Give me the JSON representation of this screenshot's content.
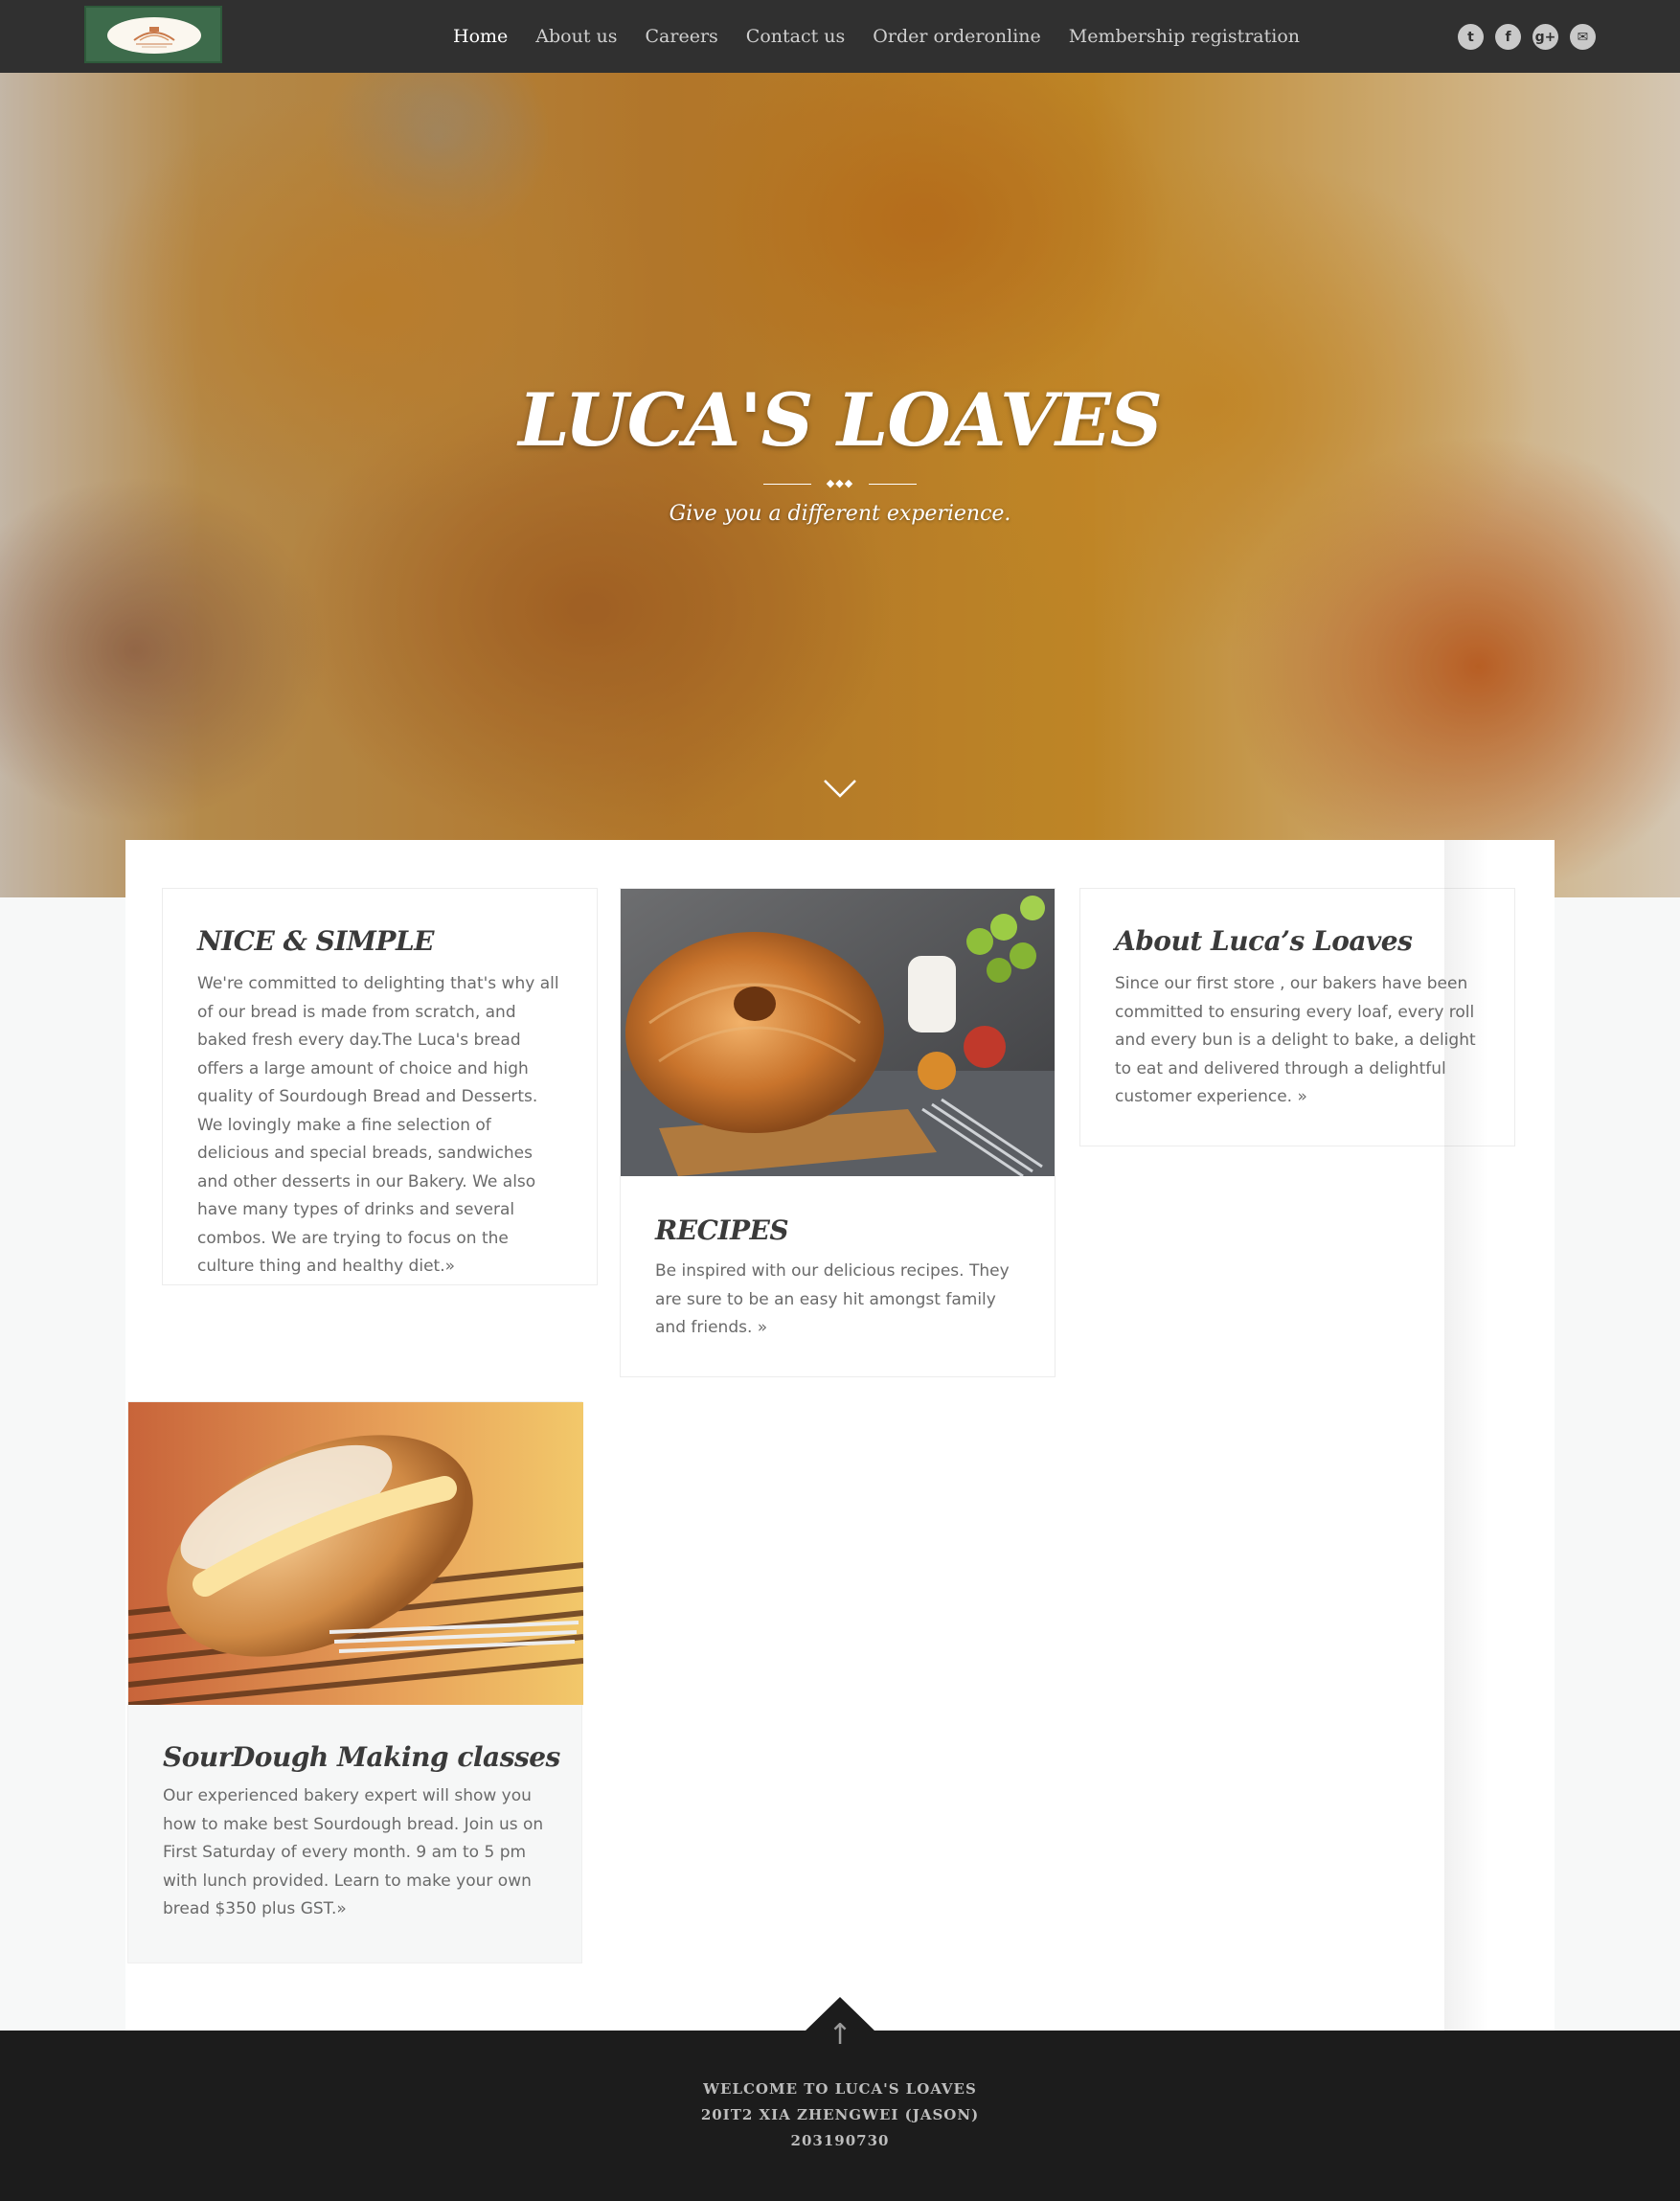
{
  "nav": {
    "logo_alt": "Luca's Loaves logo",
    "items": [
      {
        "label": "Home",
        "active": true
      },
      {
        "label": "About us",
        "active": false
      },
      {
        "label": "Careers",
        "active": false
      },
      {
        "label": "Contact us",
        "active": false
      },
      {
        "label": "Order orderonline",
        "active": false
      },
      {
        "label": "Membership registration",
        "active": false
      }
    ],
    "social": [
      {
        "name": "twitter-icon",
        "glyph": "t"
      },
      {
        "name": "facebook-icon",
        "glyph": "f"
      },
      {
        "name": "google-plus-icon",
        "glyph": "g+"
      },
      {
        "name": "email-icon",
        "glyph": "✉"
      }
    ]
  },
  "hero": {
    "title": "LUCA'S LOAVES",
    "divider": "◆◆◆",
    "subtitle": "Give you a different experience."
  },
  "cards": {
    "nice": {
      "title": "NICE & SIMPLE",
      "text": "We're committed to delighting that's why all of our bread is made from scratch, and baked fresh every day.The Luca's bread offers a large amount of choice and high quality of Sourdough Bread and Desserts. We lovingly make a fine selection of delicious and special breads, sandwiches and other desserts in our Bakery. We also have many types of drinks and several combos. We are trying to focus on the culture thing and healthy diet.»"
    },
    "recipes": {
      "title": "RECIPES",
      "text": "Be inspired with our delicious recipes. They are sure to be an easy hit amongst family and friends. »"
    },
    "about": {
      "title": "About Luca’s Loaves",
      "text": "Since our first store , our bakers have been committed to ensuring every loaf, every roll and every bun is a delight to bake, a delight to eat and delivered through a delightful customer experience. »"
    },
    "classes": {
      "title": "SourDough Making classes",
      "text": "Our experienced bakery expert will show you how to make best Sourdough bread. Join us on First Saturday of every month. 9 am to 5 pm with lunch provided. Learn to make your own bread $350 plus GST.»"
    }
  },
  "footer": {
    "to_top": "↑",
    "line1": "WELCOME TO LUCA'S LOAVES",
    "line2": "20IT2 XIA ZHENGWEI (JASON)",
    "line3": "203190730"
  },
  "colors": {
    "navbar": "#303030",
    "footer": "#1c1c1c",
    "heading": "#3a3a3a",
    "body_text": "#6a6a6a",
    "logo_green": "#3d6b4b"
  }
}
